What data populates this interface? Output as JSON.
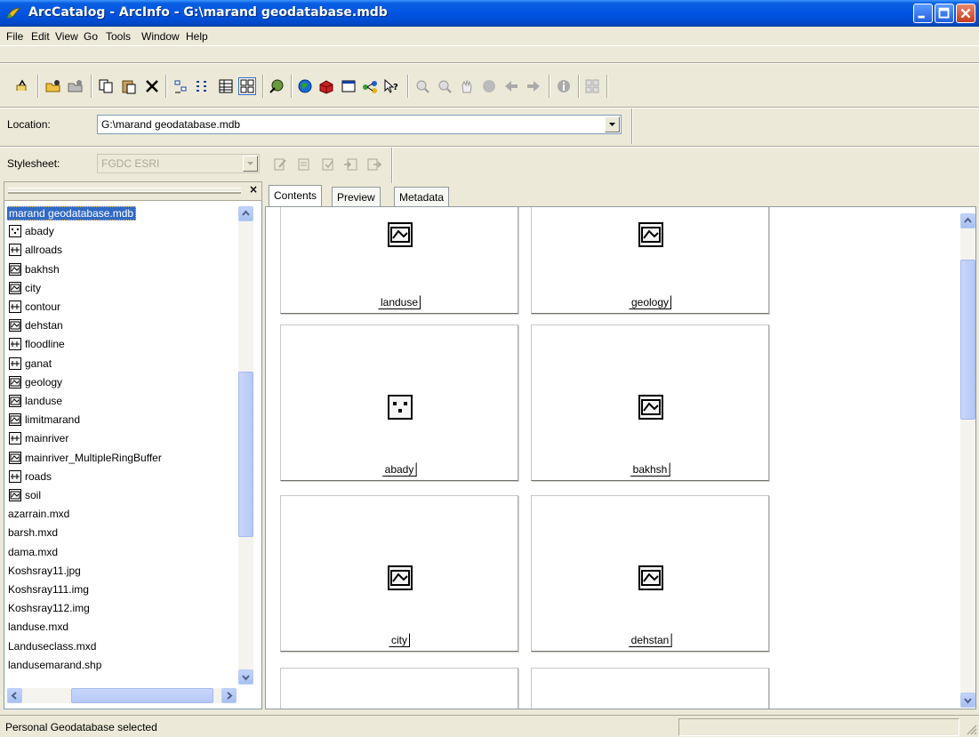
{
  "window": {
    "title": "ArcCatalog - ArcInfo - G:\\marand geodatabase.mdb"
  },
  "menu": [
    "File",
    "Edit",
    "View",
    "Go",
    "Tools",
    "Window",
    "Help"
  ],
  "location": {
    "label": "Location:",
    "value": "G:\\marand geodatabase.mdb"
  },
  "stylesheet": {
    "label": "Stylesheet:",
    "value": "FGDC ESRI"
  },
  "tree": {
    "items": [
      {
        "label": "marand geodatabase.mdb",
        "kind": "root"
      },
      {
        "label": "abady",
        "kind": "point"
      },
      {
        "label": "allroads",
        "kind": "line"
      },
      {
        "label": "bakhsh",
        "kind": "polygon"
      },
      {
        "label": "city",
        "kind": "polygon"
      },
      {
        "label": "contour",
        "kind": "line"
      },
      {
        "label": "dehstan",
        "kind": "polygon"
      },
      {
        "label": "floodline",
        "kind": "line"
      },
      {
        "label": "ganat",
        "kind": "line"
      },
      {
        "label": "geology",
        "kind": "polygon"
      },
      {
        "label": "landuse",
        "kind": "polygon"
      },
      {
        "label": "limitmarand",
        "kind": "polygon"
      },
      {
        "label": "mainriver",
        "kind": "line"
      },
      {
        "label": "mainriver_MultipleRingBuffer",
        "kind": "polygon"
      },
      {
        "label": "roads",
        "kind": "line"
      },
      {
        "label": "soil",
        "kind": "polygon"
      },
      {
        "label": "azarrain.mxd",
        "kind": "file"
      },
      {
        "label": "barsh.mxd",
        "kind": "file"
      },
      {
        "label": "dama.mxd",
        "kind": "file"
      },
      {
        "label": "Koshsray11.jpg",
        "kind": "file"
      },
      {
        "label": "Koshsray111.img",
        "kind": "file"
      },
      {
        "label": "Koshsray112.img",
        "kind": "file"
      },
      {
        "label": "landuse.mxd",
        "kind": "file"
      },
      {
        "label": "Landuseclass.mxd",
        "kind": "file"
      },
      {
        "label": "landusemarand.shp",
        "kind": "file"
      }
    ]
  },
  "tabs": [
    "Contents",
    "Preview",
    "Metadata"
  ],
  "cards": [
    {
      "label": "landuse",
      "kind": "polygon"
    },
    {
      "label": "geology",
      "kind": "polygon"
    },
    {
      "label": "abady",
      "kind": "point"
    },
    {
      "label": "bakhsh",
      "kind": "polygon"
    },
    {
      "label": "city",
      "kind": "polygon"
    },
    {
      "label": "dehstan",
      "kind": "polygon"
    },
    {
      "label": "",
      "kind": "empty"
    },
    {
      "label": "",
      "kind": "empty"
    }
  ],
  "status": {
    "text": "Personal Geodatabase selected"
  },
  "colors": {
    "titlebar": "#0054e3",
    "selection": "#316ac5",
    "chrome": "#ece9d8"
  }
}
